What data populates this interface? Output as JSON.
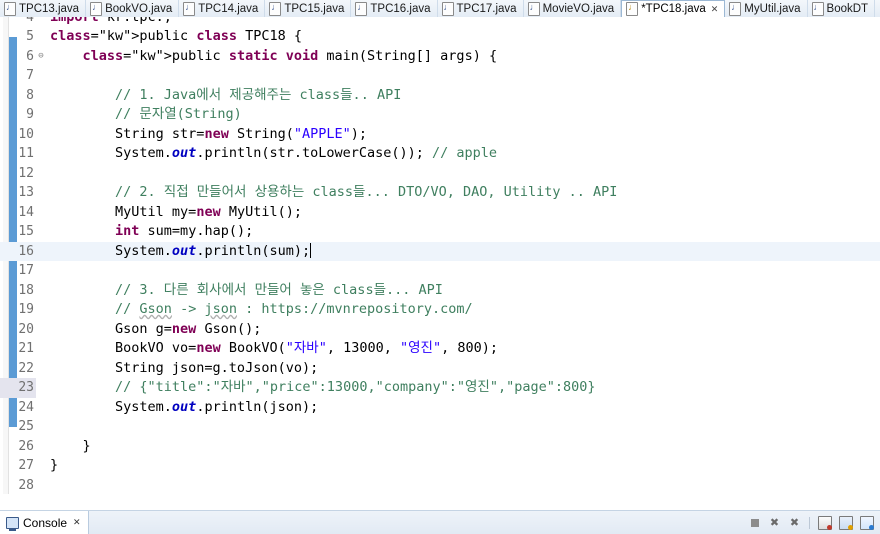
{
  "tabs": [
    {
      "label": "TPC13.java",
      "icon": "java-file-icon",
      "active": false,
      "dirty": false
    },
    {
      "label": "BookVO.java",
      "icon": "java-file-icon",
      "active": false,
      "dirty": false
    },
    {
      "label": "TPC14.java",
      "icon": "java-file-icon",
      "active": false,
      "dirty": false
    },
    {
      "label": "TPC15.java",
      "icon": "java-file-icon",
      "active": false,
      "dirty": false
    },
    {
      "label": "TPC16.java",
      "icon": "java-file-icon",
      "active": false,
      "dirty": false
    },
    {
      "label": "TPC17.java",
      "icon": "java-file-icon",
      "active": false,
      "dirty": false
    },
    {
      "label": "MovieVO.java",
      "icon": "java-file-icon",
      "active": false,
      "dirty": false
    },
    {
      "label": "*TPC18.java",
      "icon": "java-file-icon",
      "active": true,
      "dirty": true,
      "close": "✕"
    },
    {
      "label": "MyUtil.java",
      "icon": "java-file-icon",
      "active": false,
      "dirty": false
    },
    {
      "label": "BookDT",
      "icon": "java-file-icon",
      "active": false,
      "dirty": false
    }
  ],
  "editor": {
    "clipped_top_line": {
      "number": "4",
      "text": "import kr.tpc.;"
    },
    "lines": [
      {
        "n": "5",
        "fold": "",
        "cur": false,
        "hl": false
      },
      {
        "n": "6",
        "fold": "⊖",
        "cur": false,
        "hl": false
      },
      {
        "n": "7",
        "fold": "",
        "cur": false,
        "hl": false
      },
      {
        "n": "8",
        "fold": "",
        "cur": false,
        "hl": false
      },
      {
        "n": "9",
        "fold": "",
        "cur": false,
        "hl": false
      },
      {
        "n": "10",
        "fold": "",
        "cur": false,
        "hl": false
      },
      {
        "n": "11",
        "fold": "",
        "cur": false,
        "hl": false
      },
      {
        "n": "12",
        "fold": "",
        "cur": false,
        "hl": false
      },
      {
        "n": "13",
        "fold": "",
        "cur": false,
        "hl": false
      },
      {
        "n": "14",
        "fold": "",
        "cur": false,
        "hl": false
      },
      {
        "n": "15",
        "fold": "",
        "cur": false,
        "hl": false
      },
      {
        "n": "16",
        "fold": "",
        "cur": true,
        "hl": false
      },
      {
        "n": "17",
        "fold": "",
        "cur": false,
        "hl": false
      },
      {
        "n": "18",
        "fold": "",
        "cur": false,
        "hl": false
      },
      {
        "n": "19",
        "fold": "",
        "cur": false,
        "hl": false
      },
      {
        "n": "20",
        "fold": "",
        "cur": false,
        "hl": false
      },
      {
        "n": "21",
        "fold": "",
        "cur": false,
        "hl": false
      },
      {
        "n": "22",
        "fold": "",
        "cur": false,
        "hl": false
      },
      {
        "n": "23",
        "fold": "",
        "cur": false,
        "hl": true
      },
      {
        "n": "24",
        "fold": "",
        "cur": false,
        "hl": false
      },
      {
        "n": "25",
        "fold": "",
        "cur": false,
        "hl": false
      },
      {
        "n": "26",
        "fold": "",
        "cur": false,
        "hl": false
      },
      {
        "n": "27",
        "fold": "",
        "cur": false,
        "hl": false
      },
      {
        "n": "28",
        "fold": "",
        "cur": false,
        "hl": false
      }
    ],
    "source": [
      "public class TPC18 {",
      "    public static void main(String[] args) {",
      "",
      "        // 1. Java에서 제공해주는 class들.. API",
      "        // 문자열(String)",
      "        String str=new String(\"APPLE\");",
      "        System.out.println(str.toLowerCase()); // apple",
      "",
      "        // 2. 직접 만들어서 상용하는 class들... DTO/VO, DAO, Utility .. API",
      "        MyUtil my=new MyUtil();",
      "        int sum=my.hap();",
      "        System.out.println(sum);",
      "",
      "        // 3. 다른 회사에서 만들어 놓은 class들... API",
      "        // Gson -> json : https://mvnrepository.com/",
      "        Gson g=new Gson();",
      "        BookVO vo=new BookVO(\"자바\", 13000, \"영진\", 800);",
      "        String json=g.toJson(vo);",
      "        // {\"title\":\"자바\",\"price\":13000,\"company\":\"영진\",\"page\":800}",
      "        System.out.println(json);",
      "",
      "    }",
      "}",
      ""
    ],
    "caret_line": "16"
  },
  "hscrollbar": {
    "left_arrow": "‹"
  },
  "console": {
    "tab_label": "Console",
    "close": "✕",
    "tools": [
      {
        "name": "terminate-icon",
        "glyph": "■"
      },
      {
        "name": "remove-launch-icon",
        "glyph": "✖"
      },
      {
        "name": "remove-all-terminated-icon",
        "glyph": "✖"
      },
      {
        "name": "clear-console-icon",
        "glyph": ""
      },
      {
        "name": "scroll-lock-icon",
        "glyph": ""
      },
      {
        "name": "pin-console-icon",
        "glyph": ""
      }
    ]
  },
  "colors": {
    "keyword": "#7F0055",
    "comment": "#3F7F5F",
    "string": "#2A00FF",
    "field": "#0000C0",
    "local": "#6A3E3E",
    "diff_bar": "#5B9BD5",
    "current_line": "#EEF4FB"
  }
}
